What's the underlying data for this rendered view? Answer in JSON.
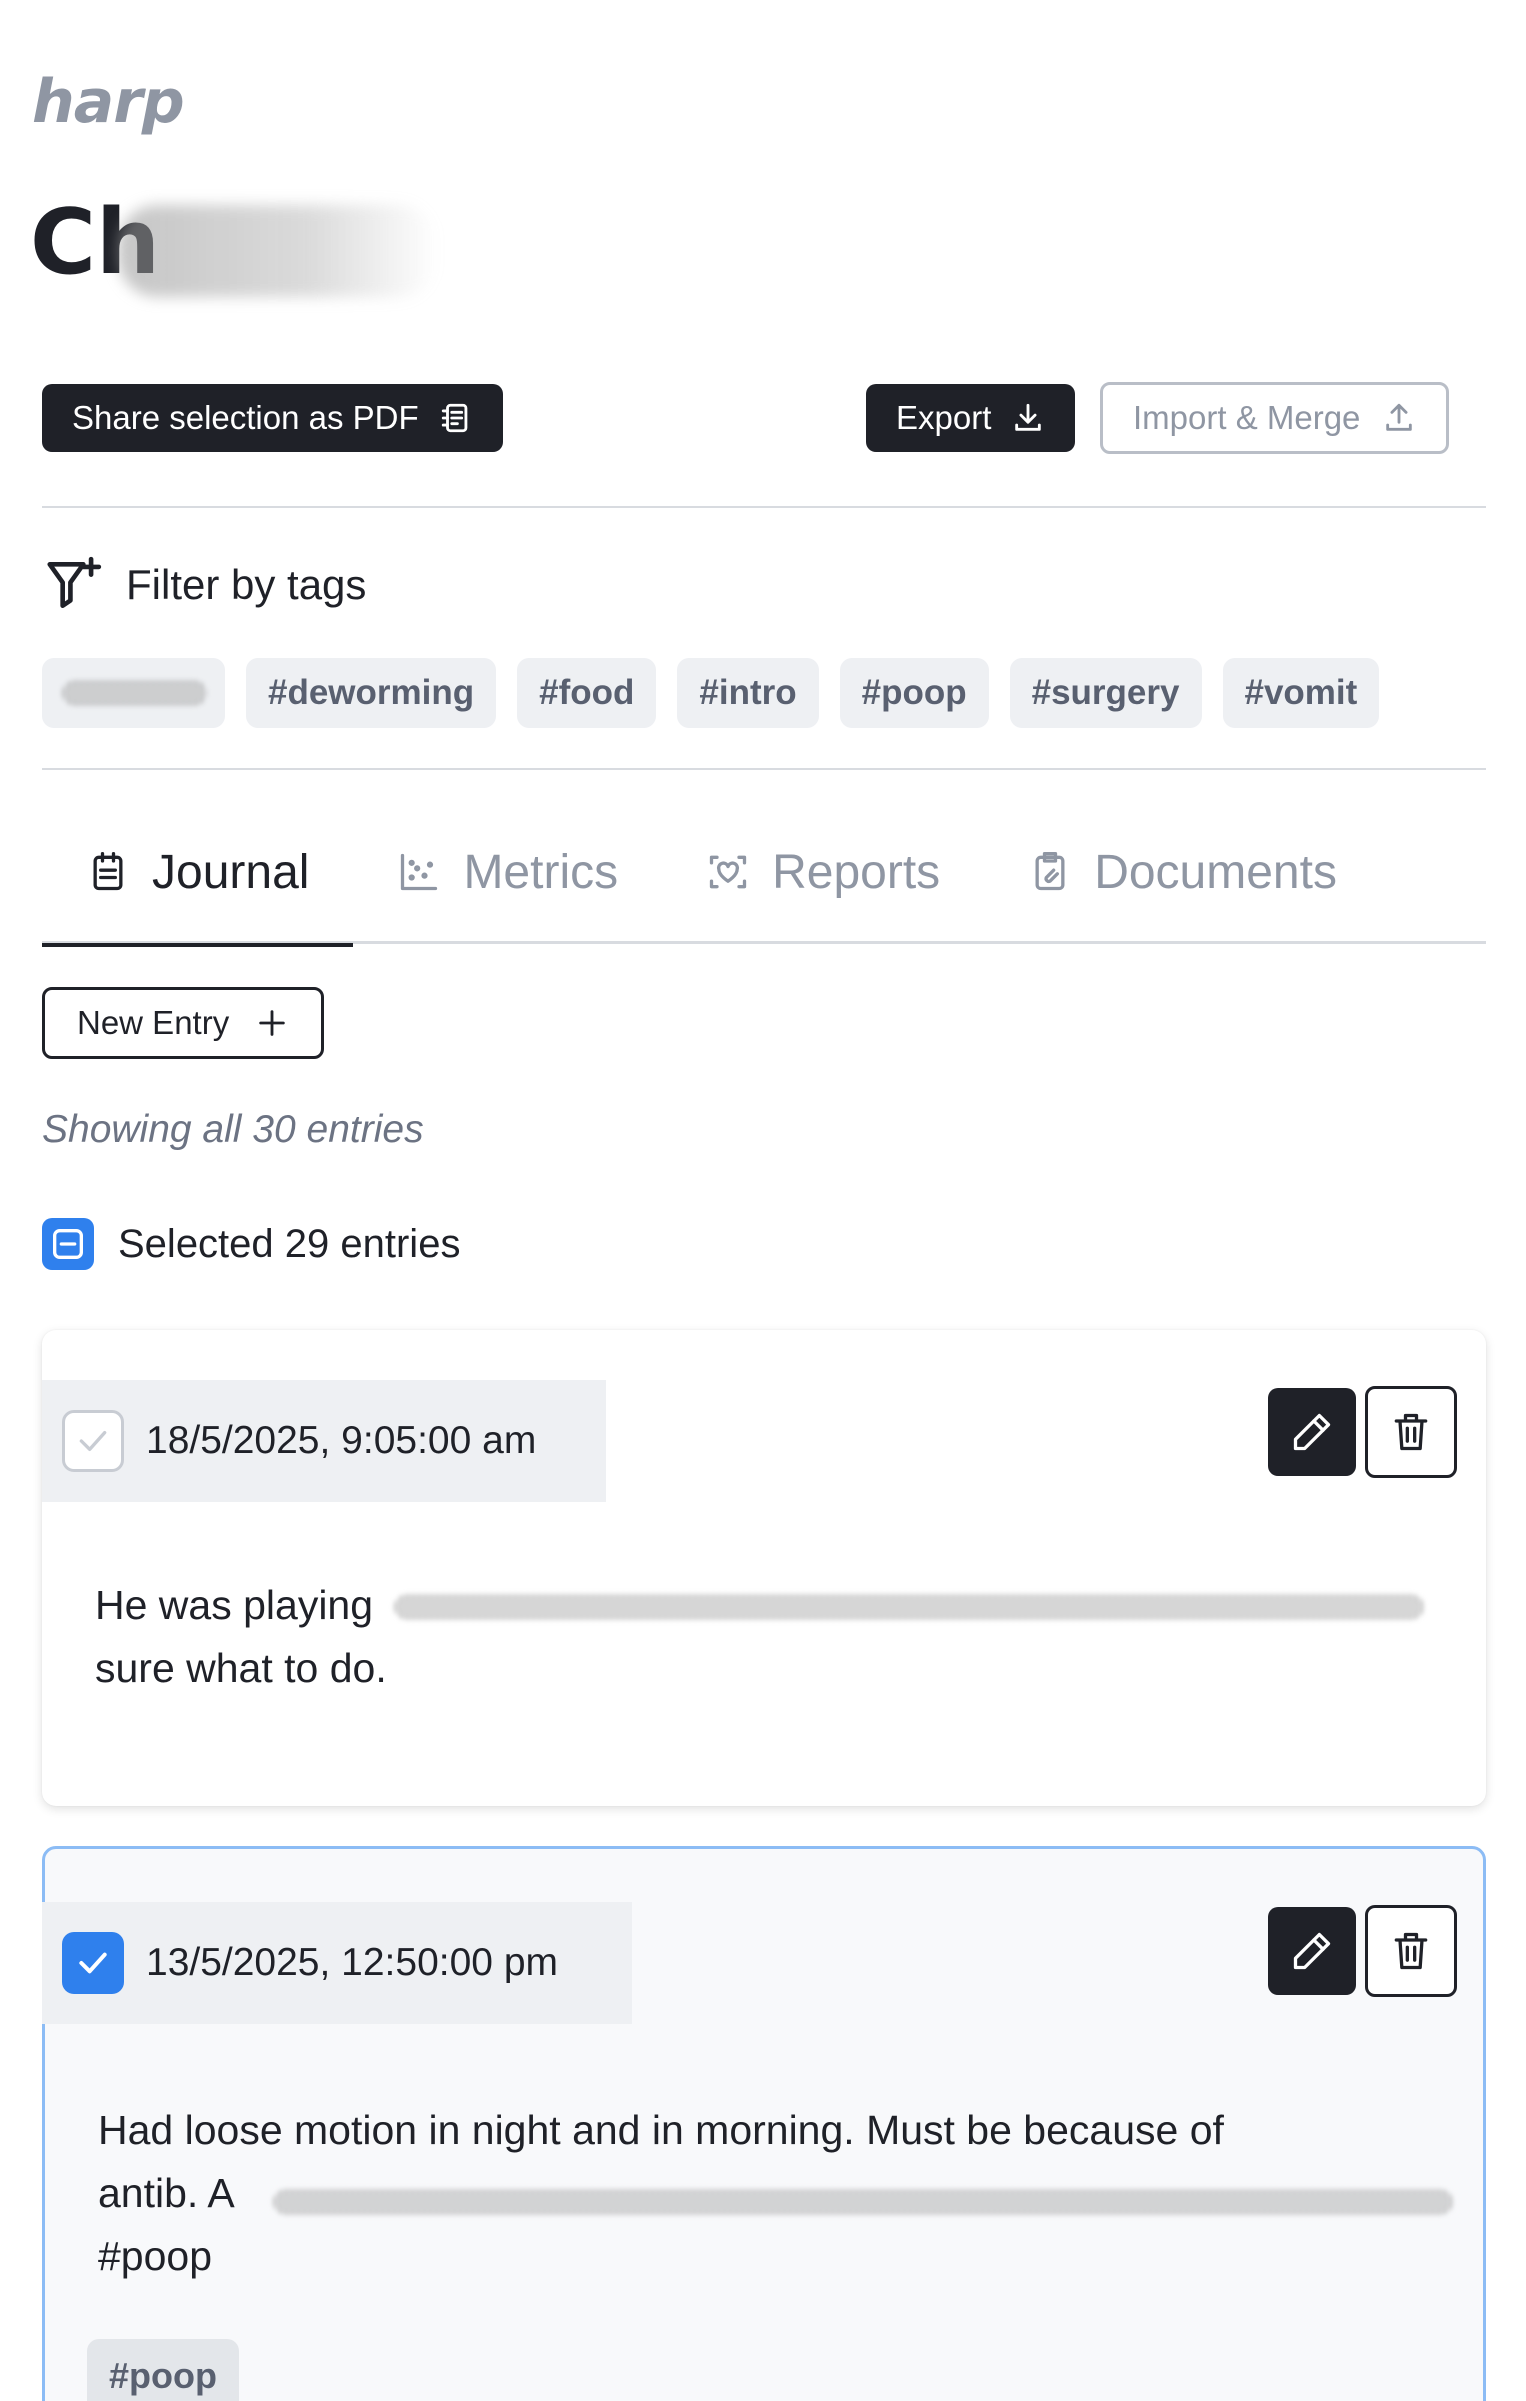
{
  "brand": "harp",
  "pet": {
    "name_visible": "Ch"
  },
  "toolbar": {
    "share_pdf": "Share selection as PDF",
    "export": "Export",
    "import_merge": "Import & Merge"
  },
  "filter": {
    "label": "Filter by tags",
    "tags": [
      "#deworming",
      "#food",
      "#intro",
      "#poop",
      "#surgery",
      "#vomit"
    ]
  },
  "tabs": [
    {
      "label": "Journal",
      "icon": "clipboard-icon",
      "active": true
    },
    {
      "label": "Metrics",
      "icon": "scatter-chart-icon",
      "active": false
    },
    {
      "label": "Reports",
      "icon": "heart-scan-icon",
      "active": false
    },
    {
      "label": "Documents",
      "icon": "clipboard-paperclip-icon",
      "active": false
    }
  ],
  "new_entry": "New Entry",
  "showing": "Showing all 30 entries",
  "selection": {
    "text": "Selected 29 entries",
    "state": "indeterminate"
  },
  "entries": [
    {
      "timestamp": "18/5/2025, 9:05:00 am",
      "checked": false,
      "line1_visible": "He was playing",
      "line2": "sure what to do."
    },
    {
      "timestamp": "13/5/2025, 12:50:00 pm",
      "checked": true,
      "line1": "Had loose motion in night and in morning. Must be because of",
      "line2_visible": "antib. A",
      "line3": "#poop",
      "tag": "#poop"
    }
  ],
  "colors": {
    "dark": "#1f2128",
    "accent_blue": "#2f80ed",
    "muted": "#8f96a3",
    "selected_border": "#8cbcf5",
    "tag_bg": "#eef0f3"
  }
}
